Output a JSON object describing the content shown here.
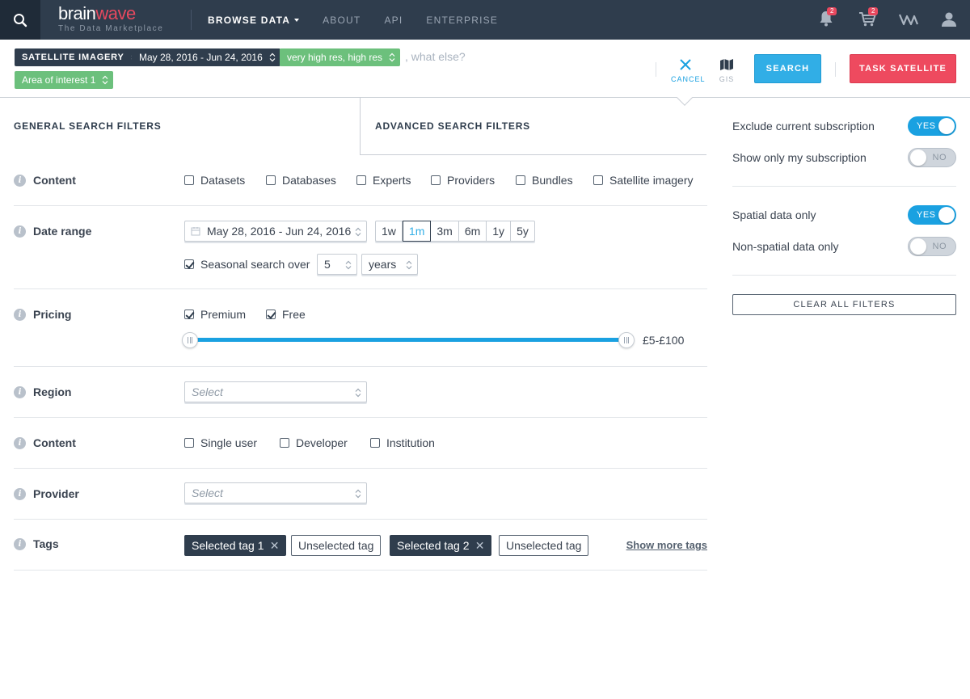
{
  "header": {
    "logo_brain": "brain",
    "logo_wave": "wave",
    "logo_tagline": "The Data Marketplace",
    "nav": [
      {
        "label": "Browse Data",
        "active": true
      },
      {
        "label": "About",
        "active": false
      },
      {
        "label": "API",
        "active": false
      },
      {
        "label": "Enterprise",
        "active": false
      }
    ],
    "notifications_count": "2",
    "cart_count": "2"
  },
  "query": {
    "pills": [
      {
        "label": "SATELLITE IMAGERY",
        "style": "dark"
      },
      {
        "label": "May 28, 2016 - Jun 24, 2016",
        "style": "dark"
      },
      {
        "label": "very high res, high res",
        "style": "green"
      },
      {
        "label": "Area of interest 1",
        "style": "green"
      }
    ],
    "placeholder": ", what else?",
    "cancel_label": "CANCEL",
    "gis_label": "GIS",
    "search_label": "SEARCH",
    "task_label": "TASK SATELLITE"
  },
  "tabs": {
    "general": "General search filters",
    "advanced": "Advanced search filters"
  },
  "filters": {
    "content": {
      "label": "Content",
      "options": [
        "Datasets",
        "Databases",
        "Experts",
        "Providers",
        "Bundles",
        "Satellite imagery"
      ]
    },
    "date_range": {
      "label": "Date range",
      "value": "May 28, 2016 - Jun 24, 2016",
      "periods": [
        "1w",
        "1m",
        "3m",
        "6m",
        "1y",
        "5y"
      ],
      "active_period": "1m",
      "seasonal_label": "Seasonal search over",
      "seasonal_checked": true,
      "seasonal_count": "5",
      "seasonal_unit": "years"
    },
    "pricing": {
      "label": "Pricing",
      "premium": "Premium",
      "free": "Free",
      "range_label": "£5-£100"
    },
    "region": {
      "label": "Region",
      "placeholder": "Select"
    },
    "licence": {
      "label": "Content",
      "options": [
        "Single user",
        "Developer",
        "Institution"
      ]
    },
    "provider": {
      "label": "Provider",
      "placeholder": "Select"
    },
    "tags": {
      "label": "Tags",
      "items": [
        {
          "label": "Selected tag 1",
          "selected": true
        },
        {
          "label": "Unselected tag",
          "selected": false
        },
        {
          "label": "Selected tag 2",
          "selected": true
        },
        {
          "label": "Unselected tag",
          "selected": false
        }
      ],
      "more_label": "Show more tags"
    }
  },
  "side": {
    "toggles": [
      {
        "label": "Exclude current subscription",
        "state": "YES"
      },
      {
        "label": "Show only my subscription",
        "state": "NO"
      },
      {
        "label": "Spatial data only",
        "state": "YES"
      },
      {
        "label": "Non-spatial data only",
        "state": "NO"
      }
    ],
    "clear_label": "CLEAR ALL FILTERS"
  },
  "colors": {
    "nav_bg": "#2f3d4d",
    "accent_blue": "#31aee6",
    "accent_red": "#ee4a5f",
    "pill_green": "#6cc07c",
    "pill_dark": "#2f3d4d"
  }
}
